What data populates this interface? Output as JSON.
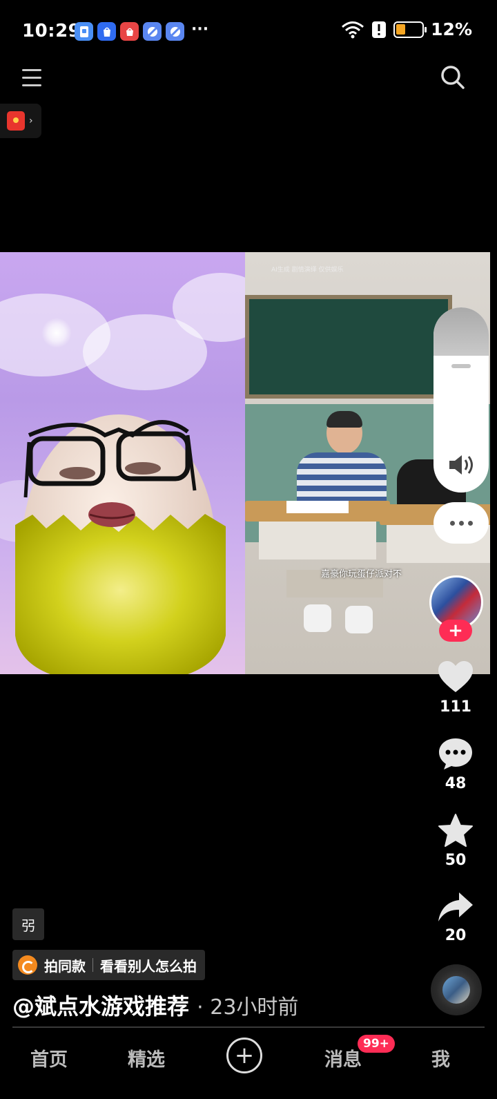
{
  "status_bar": {
    "time": "10:29",
    "battery_percent": "12%",
    "battery_level": 0.12,
    "notification_icons": [
      "app-gallery-icon",
      "appmarket-icon",
      "huawei-store-icon",
      "browser-icon",
      "browser-icon"
    ],
    "more": "···"
  },
  "video": {
    "caption": "嘉豪你玩蛋仔派对不",
    "watermark": "AI生成 剧情演绎 仅供娱乐"
  },
  "rail": {
    "like_count": "111",
    "comment_count": "48",
    "favorite_count": "50",
    "share_count": "20",
    "follow_symbol": "+"
  },
  "info": {
    "tag": "弜",
    "template_label": "拍同款",
    "template_link": "看看别人怎么拍",
    "author": "@斌点水游戏推荐",
    "time_ago": "· 23小时前"
  },
  "nav": {
    "home": "首页",
    "featured": "精选",
    "add": "+",
    "messages": "消息",
    "messages_badge": "99+",
    "me": "我"
  },
  "colors": {
    "accent": "#fe2c55",
    "battery_low": "#f5a623",
    "background": "#000000"
  }
}
